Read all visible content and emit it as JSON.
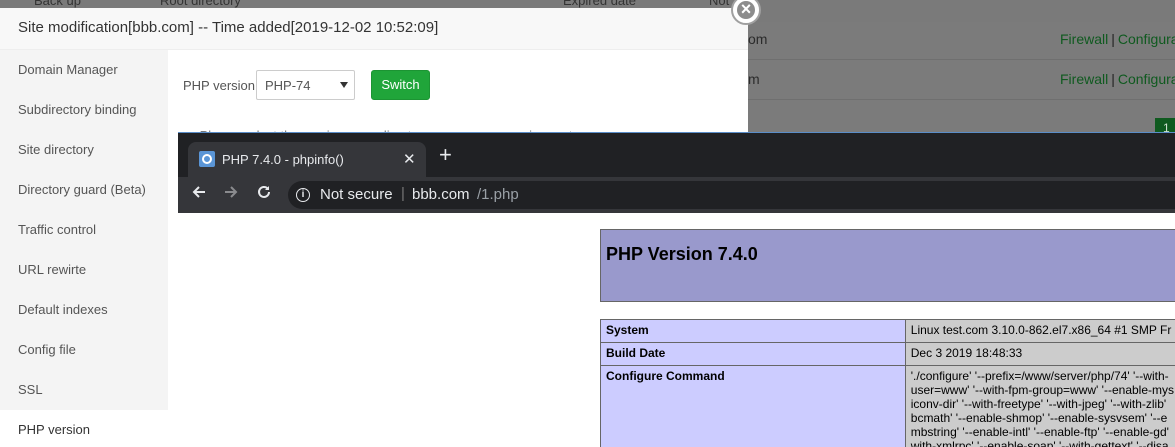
{
  "background": {
    "columns": [
      "Back up",
      "Root directory",
      "Expired date",
      "Not"
    ],
    "rows": [
      {
        "fragment": "om",
        "link1": "Firewall",
        "separator": "|",
        "link2": "Configura"
      },
      {
        "fragment": "m",
        "link1": "Firewall",
        "separator": "|",
        "link2": "Configura"
      }
    ],
    "badge": "1"
  },
  "modal": {
    "title": "Site modification[bbb.com] -- Time added[2019-12-02 10:52:09]",
    "close_symbol": "×",
    "sidebar": [
      {
        "label": "Domain Manager"
      },
      {
        "label": "Subdirectory binding"
      },
      {
        "label": "Site directory"
      },
      {
        "label": "Directory guard (Beta)"
      },
      {
        "label": "Traffic control"
      },
      {
        "label": "URL rewirte"
      },
      {
        "label": "Default indexes"
      },
      {
        "label": "Config file"
      },
      {
        "label": "SSL"
      },
      {
        "label": "PHP version"
      }
    ],
    "php": {
      "label": "PHP version",
      "selected": "PHP-74",
      "switch_label": "Switch",
      "hint": "Please select the version according to your program requirements"
    }
  },
  "browser": {
    "tab_title": "PHP 7.4.0 - phpinfo()",
    "tab_close": "✕",
    "new_tab": "+",
    "security": "Not secure",
    "url_separator": "|",
    "url_host": "bbb.com",
    "url_path": "/1.php",
    "icons": {
      "back": "arrow-left",
      "forward": "arrow-right",
      "reload": "reload",
      "info": "info"
    },
    "phpinfo": {
      "heading": "PHP Version 7.4.0",
      "rows": [
        {
          "key": "System",
          "value": [
            "Linux test.com 3.10.0-862.el7.x86_64 #1 SMP Fr"
          ]
        },
        {
          "key": "Build Date",
          "value": [
            "Dec 3 2019 18:48:33"
          ]
        },
        {
          "key": "Configure Command",
          "value": [
            "'./configure' '--prefix=/www/server/php/74' '--with-",
            "user=www' '--with-fpm-group=www' '--enable-mys",
            "iconv-dir' '--with-freetype' '--with-jpeg' '--with-zlib'",
            "bcmath' '--enable-shmop' '--enable-sysvsem' '--e",
            "mbstring' '--enable-intl' '--enable-ftp' '--enable-gd'",
            "with-xmlrpc' '--enable-soap' '--with-gettext' '--disa"
          ]
        }
      ]
    }
  },
  "colors": {
    "accent_green": "#20a53a",
    "php_header": "#9999cc",
    "php_key": "#ccccff",
    "php_value": "#cccccc",
    "browser_dark": "#202124"
  }
}
